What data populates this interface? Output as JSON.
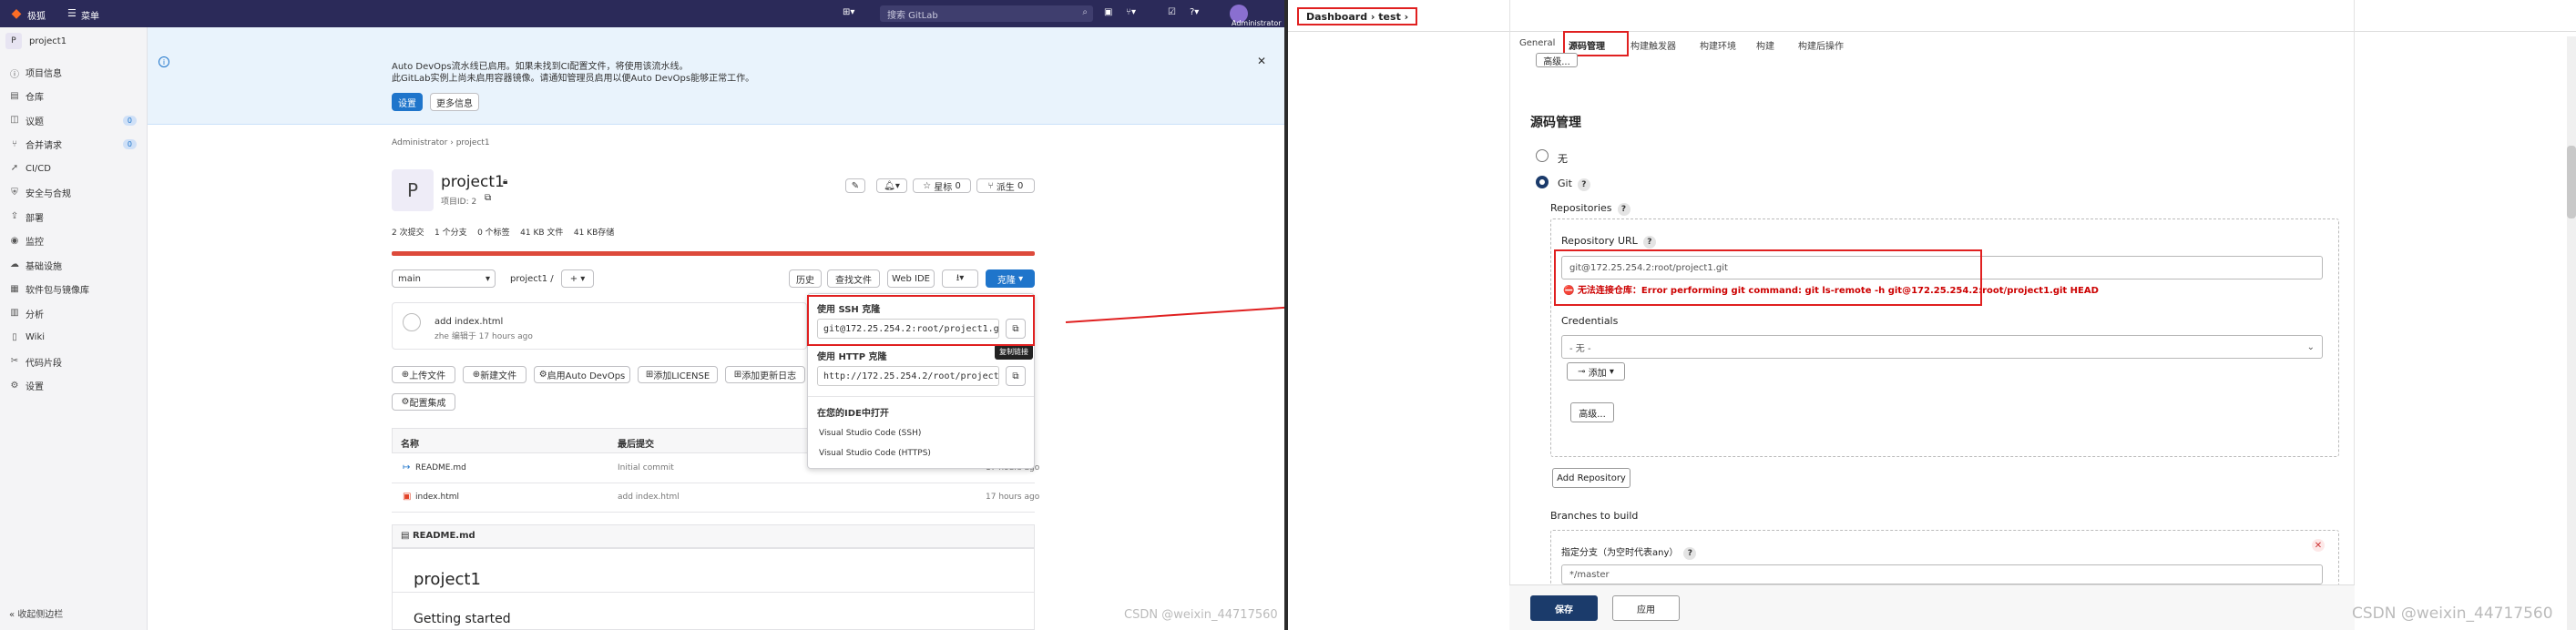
{
  "gitlab": {
    "topbar": {
      "logo_text": "极狐",
      "menu_label": "菜单",
      "search_placeholder": "搜索 GitLab",
      "user_label": "Administrator"
    },
    "sidebar": {
      "project_initial": "P",
      "project_name": "project1",
      "items": [
        {
          "label": "项目信息",
          "icon": "info-icon"
        },
        {
          "label": "仓库",
          "icon": "repo-icon"
        },
        {
          "label": "议题",
          "icon": "issues-icon",
          "count": "0"
        },
        {
          "label": "合并请求",
          "icon": "merge-request-icon",
          "count": "0"
        },
        {
          "label": "CI/CD",
          "icon": "rocket-icon"
        },
        {
          "label": "安全与合规",
          "icon": "shield-icon"
        },
        {
          "label": "部署",
          "icon": "deploy-icon"
        },
        {
          "label": "监控",
          "icon": "monitor-icon"
        },
        {
          "label": "基础设施",
          "icon": "infrastructure-icon"
        },
        {
          "label": "软件包与镜像库",
          "icon": "package-icon"
        },
        {
          "label": "分析",
          "icon": "chart-icon"
        },
        {
          "label": "Wiki",
          "icon": "book-icon"
        },
        {
          "label": "代码片段",
          "icon": "snippet-icon"
        },
        {
          "label": "设置",
          "icon": "gear-icon"
        }
      ],
      "collapse_label": "收起侧边栏"
    },
    "banner": {
      "line1": "Auto DevOps流水线已启用。如果未找到CI配置文件，将使用该流水线。",
      "line2": "此GitLab实例上尚未启用容器镜像。请通知管理员启用以便Auto DevOps能够正常工作。",
      "settings_button": "设置",
      "more_info_button": "更多信息"
    },
    "breadcrumb": {
      "owner": "Administrator",
      "project": "project1"
    },
    "project": {
      "initial": "P",
      "name": "project1",
      "id_label": "项目ID: 2",
      "star_label": "星标",
      "star_count": "0",
      "fork_label": "派生",
      "fork_count": "0",
      "stats": [
        "2 次提交",
        "1 个分支",
        "0 个标签",
        "41 KB 文件",
        "41 KB存储"
      ]
    },
    "toolbar": {
      "branch": "main",
      "path": "project1",
      "history": "历史",
      "find_file": "查找文件",
      "web_ide": "Web IDE",
      "clone": "克隆"
    },
    "commit": {
      "title": "add index.html",
      "meta": "zhe 编辑于 17 hours ago"
    },
    "clone_dropdown": {
      "ssh_title": "使用 SSH 克隆",
      "ssh_url": "git@172.25.254.2:root/project1.git",
      "copy_tooltip": "复制链接",
      "http_title": "使用 HTTP 克隆",
      "http_url": "http://172.25.254.2/root/project1.",
      "ide_title": "在您的IDE中打开",
      "ide_ssh": "Visual Studio Code (SSH)",
      "ide_https": "Visual Studio Code (HTTPS)"
    },
    "actions": [
      "上传文件",
      "新建文件",
      "启用Auto DevOps",
      "添加LICENSE",
      "添加更新日志",
      "配置集成"
    ],
    "file_table": {
      "headers": [
        "名称",
        "最后提交",
        ""
      ],
      "rows": [
        {
          "name": "README.md",
          "commit": "Initial commit",
          "time": "17 hours ago"
        },
        {
          "name": "index.html",
          "commit": "add index.html",
          "time": "17 hours ago"
        }
      ]
    },
    "readme": {
      "file": "README.md",
      "heading": "project1",
      "subheading": "Getting started"
    },
    "watermark": "CSDN @weixin_44717560"
  },
  "jenkins": {
    "breadcrumb": {
      "dashboard": "Dashboard",
      "job": "test"
    },
    "tabs": [
      "General",
      "源码管理",
      "构建触发器",
      "构建环境",
      "构建",
      "构建后操作"
    ],
    "advanced_top": "高级...",
    "section_title": "源码管理",
    "scm_none": "无",
    "scm_git": "Git",
    "repositories_label": "Repositories",
    "repo_url_label": "Repository URL",
    "repo_url_value": "git@172.25.254.2:root/project1.git",
    "error_text": "无法连接仓库：Error performing git command: git ls-remote -h git@172.25.254.2:root/project1.git HEAD",
    "credentials_label": "Credentials",
    "credentials_value": "- 无 -",
    "add_button": "添加",
    "advanced_button": "高级...",
    "add_repo_button": "Add Repository",
    "branches_label": "Branches to build",
    "branch_spec_label": "指定分支（为空时代表any）",
    "branch_spec_value": "*/master",
    "save_button": "保存",
    "apply_button": "应用",
    "watermark": "CSDN @weixin_44717560"
  },
  "colors": {
    "gitlab_nav": "#2b2a59",
    "accent_blue": "#1f75cb",
    "annotation_red": "#e02020",
    "jenkins_save": "#1b3b6b",
    "error_red": "#cc0000"
  }
}
